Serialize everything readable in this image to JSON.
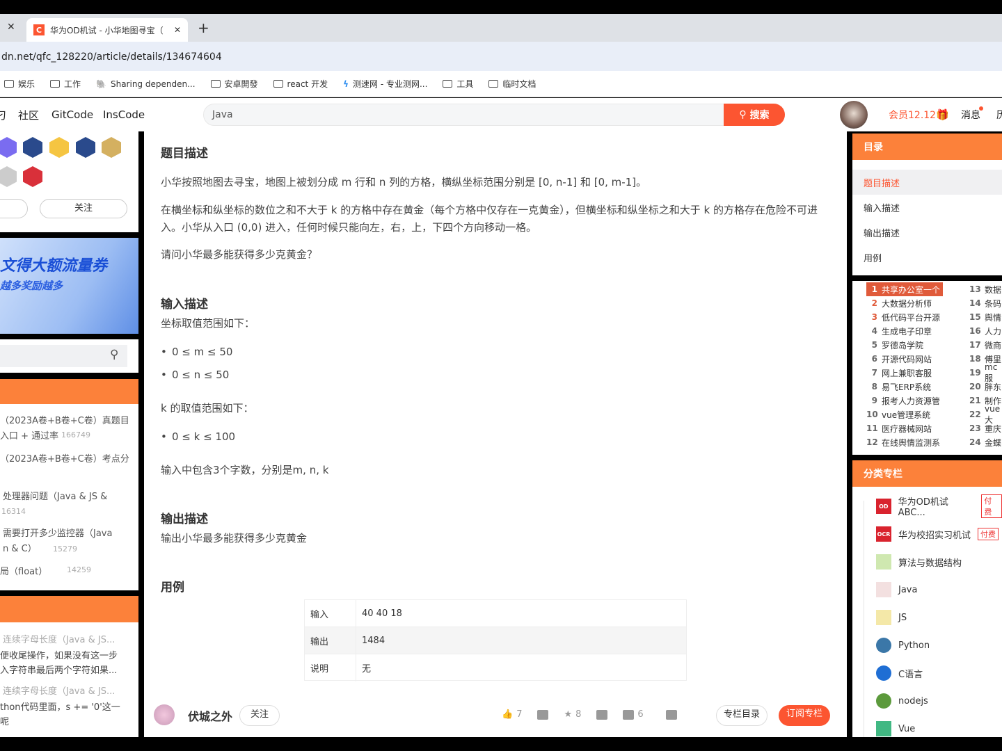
{
  "browser": {
    "tab_close": "✕",
    "active_tab_title": "华为OD机试 - 小华地图寻宝（",
    "new_tab": "+",
    "url": "dn.net/qfc_128220/article/details/134674604",
    "bookmarks": [
      "娱乐",
      "工作",
      "Sharing dependen...",
      "安卓開發",
      "react 开发",
      "测速网 - 专业测网...",
      "工具",
      "临时文档"
    ]
  },
  "site": {
    "nav": [
      "刁",
      "社区",
      "GitCode",
      "InsCode"
    ],
    "search_value": "Java",
    "search_button": "搜索",
    "vip": "会员12.12",
    "messages": "消息",
    "more": "历"
  },
  "left": {
    "follow": "关注",
    "banner_title": "文得大额流量券",
    "banner_sub": "越多奖励越多",
    "hot_articles": [
      {
        "text": "（2023A卷+B卷+C卷）真题目\n入口 + 通过率",
        "views": "166749"
      },
      {
        "text": "（2023A卷+B卷+C卷）考点分",
        "views": ""
      },
      {
        "text": "处理器问题（Java & JS &",
        "views": "16314"
      },
      {
        "text": "需要打开多少监控器（Java\nn & C）",
        "views": "15279"
      },
      {
        "text": "局（float）",
        "views": "14259"
      }
    ],
    "comments": [
      "连续字母长度（Java & JS...",
      "便收尾操作，如果没有这一步",
      "入字符串最后两个字符如果...",
      "连续字母长度（Java & JS...",
      "thon代码里面，s += '0'这一",
      "呢"
    ]
  },
  "article": {
    "sections": {
      "desc": "题目描述",
      "input": "输入描述",
      "output": "输出描述",
      "example": "用例"
    },
    "p1": "小华按照地图去寻宝，地图上被划分成 m 行和 n 列的方格，横纵坐标范围分别是 [0, n-1] 和 [0, m-1]。",
    "p2": "在横坐标和纵坐标的数位之和不大于 k 的方格中存在黄金（每个方格中仅存在一克黄金），但横坐标和纵坐标之和大于 k 的方格存在危险不可进入。小华从入口 (0,0) 进入，任何时候只能向左，右，上，下四个方向移动一格。",
    "p3": "请问小华最多能获得多少克黄金？",
    "in1": "坐标取值范围如下：",
    "in_li": [
      "0 ≤ m ≤ 50",
      "0 ≤ n ≤ 50"
    ],
    "in2": "k 的取值范围如下：",
    "in_li2": [
      "0 ≤ k ≤ 100"
    ],
    "in3": "输入中包含3个字数，分别是m, n, k",
    "out1": "输出小华最多能获得多少克黄金",
    "example_rows": [
      {
        "k": "输入",
        "v": "40 40 18"
      },
      {
        "k": "输出",
        "v": "1484"
      },
      {
        "k": "说明",
        "v": "无"
      }
    ],
    "author": "伏城之外",
    "follow": "关注",
    "likes": "7",
    "stars": "8",
    "comments": "6",
    "column_toc": "专栏目录",
    "subscribe": "订阅专栏"
  },
  "toc": {
    "title": "目录",
    "items": [
      "题目描述",
      "输入描述",
      "输出描述",
      "用例"
    ]
  },
  "hot_search": {
    "col1": [
      "共享办公室一个",
      "大数据分析师",
      "低代码平台开源",
      "生成电子印章",
      "罗德岛学院",
      "开源代码网站",
      "网上兼职客服",
      "易飞ERP系统",
      "报考人力资源管",
      "vue管理系统",
      "医疗器械网站",
      "在线舆情监测系"
    ],
    "col2": [
      "数据",
      "条码",
      "舆情",
      "人力",
      "微商",
      "傅里",
      "mc服",
      "胖东",
      "制作",
      "vue大",
      "重庆",
      "金蝶"
    ]
  },
  "columns": {
    "title": "分类专栏",
    "items": [
      {
        "icon": "OD",
        "name": "华为OD机试ABC...",
        "paid": "付费"
      },
      {
        "icon": "OCR",
        "name": "华为校招实习机试",
        "paid": "付费"
      },
      {
        "icon": "ALG",
        "name": "算法与数据结构"
      },
      {
        "icon": "java",
        "name": "Java"
      },
      {
        "icon": "js",
        "name": "JS"
      },
      {
        "icon": "python",
        "name": "Python"
      },
      {
        "icon": "c",
        "name": "C语言"
      },
      {
        "icon": "nodejs",
        "name": "nodejs"
      },
      {
        "icon": "vue",
        "name": "Vue"
      }
    ]
  },
  "colors": {
    "accent": "#fc5531",
    "panel_header": "#fc813a"
  }
}
